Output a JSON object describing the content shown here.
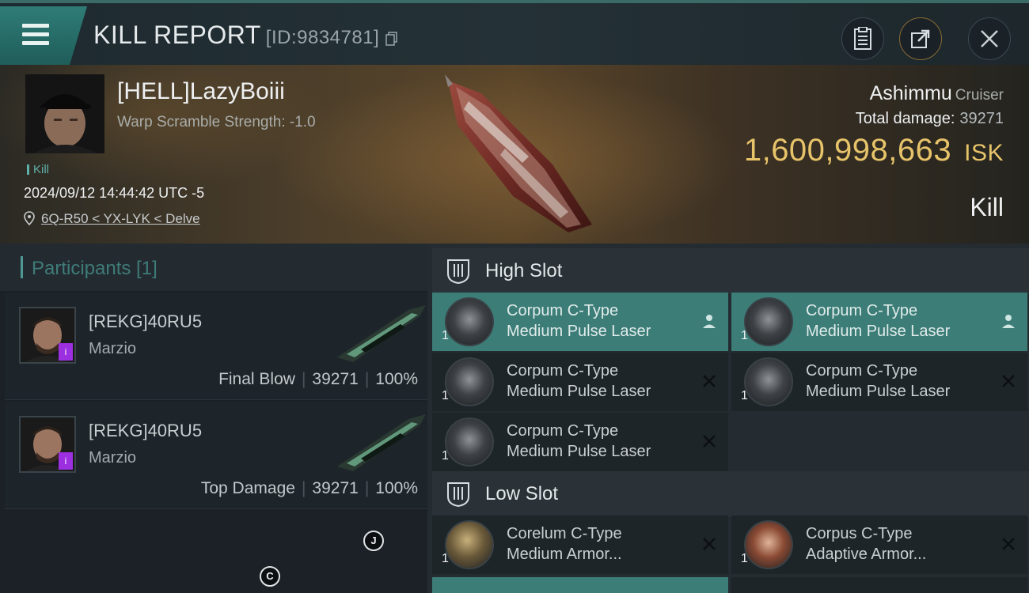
{
  "header": {
    "title": "KILL REPORT",
    "report_id": "[ID:9834781]"
  },
  "victim": {
    "name": "[HELL]LazyBoiii",
    "subtitle": "Warp Scramble Strength: -1.0",
    "tag": "Kill",
    "datetime": "2024/09/12 14:44:42 UTC -5",
    "location": "6Q-R50 < YX-LYK < Delve",
    "ship_name": "Ashimmu",
    "ship_class": "Cruiser",
    "damage_label": "Total damage:",
    "damage_value": "39271",
    "isk_value": "1,600,998,663",
    "isk_currency": "ISK",
    "result": "Kill"
  },
  "participants": {
    "title": "Participants [1]",
    "cards": [
      {
        "name": "[REKG]40RU5",
        "corp": "Marzio",
        "role": "Final Blow",
        "damage": "39271",
        "percent": "100%",
        "badge": "i"
      },
      {
        "name": "[REKG]40RU5",
        "corp": "Marzio",
        "role": "Top Damage",
        "damage": "39271",
        "percent": "100%",
        "badge": "i"
      }
    ]
  },
  "slots": {
    "high_title": "High Slot",
    "low_title": "Low Slot",
    "high": [
      {
        "qty": "1",
        "line1": "Corpum C-Type",
        "line2": "Medium Pulse Laser",
        "state": "fitted"
      },
      {
        "qty": "1",
        "line1": "Corpum C-Type",
        "line2": "Medium Pulse Laser",
        "state": "fitted"
      },
      {
        "qty": "1",
        "line1": "Corpum C-Type",
        "line2": "Medium Pulse Laser",
        "state": "destroyed"
      },
      {
        "qty": "1",
        "line1": "Corpum C-Type",
        "line2": "Medium Pulse Laser",
        "state": "destroyed"
      },
      {
        "qty": "1",
        "line1": "Corpum C-Type",
        "line2": "Medium Pulse Laser",
        "state": "destroyed"
      }
    ],
    "low": [
      {
        "qty": "1",
        "line1": "Corelum C-Type",
        "line2": "Medium Armor...",
        "state": "destroyed"
      },
      {
        "qty": "1",
        "line1": "Corpus C-Type",
        "line2": "Adaptive Armor...",
        "state": "destroyed"
      }
    ]
  },
  "overlay_marks": {
    "mark_j": "J",
    "mark_c": "C"
  },
  "colors": {
    "accent_teal": "#3c7d78",
    "isk_gold": "#e7c36a",
    "badge_purple": "#9c2fe0"
  }
}
